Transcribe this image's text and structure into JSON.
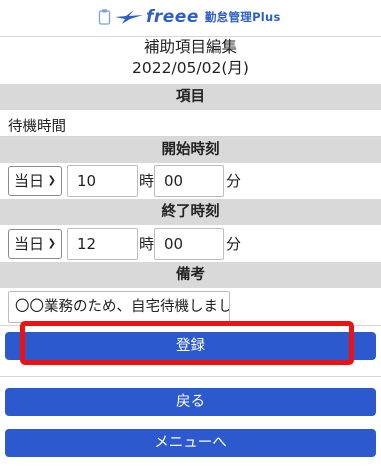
{
  "header": {
    "brand": "freee",
    "product": "勤怠管理Plus",
    "icons": [
      "clipboard-icon",
      "bird-icon"
    ],
    "brand_color": "#2e5fc7"
  },
  "page": {
    "title": "補助項目編集",
    "date": "2022/05/02(月)"
  },
  "item": {
    "header": "項目",
    "value": "待機時間"
  },
  "start_time": {
    "header": "開始時刻",
    "day": "当日",
    "hour": "10",
    "hour_unit": "時",
    "minute": "00",
    "minute_unit": "分"
  },
  "end_time": {
    "header": "終了時刻",
    "day": "当日",
    "hour": "12",
    "hour_unit": "時",
    "minute": "00",
    "minute_unit": "分"
  },
  "remarks": {
    "header": "備考",
    "value": "〇〇業務のため、自宅待機しまし"
  },
  "buttons": {
    "register": "登録",
    "back": "戻る",
    "menu": "メニューへ"
  },
  "colors": {
    "button": "#2c59cd",
    "section_bg": "#d9d9d9",
    "highlight": "#ee1111"
  }
}
